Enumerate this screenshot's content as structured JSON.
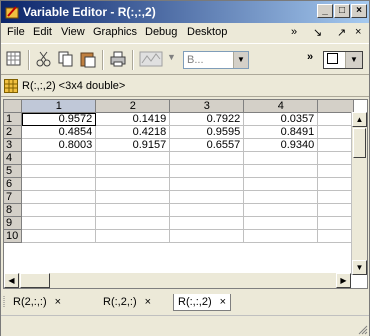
{
  "window": {
    "title": "Variable Editor - R(:,:,2)"
  },
  "title_buttons": {
    "minimize": "_",
    "maximize": "□",
    "close": "×"
  },
  "menu": {
    "items": [
      "File",
      "Edit",
      "View",
      "Graphics",
      "Debug",
      "Desktop"
    ],
    "more": "»",
    "dock": "↘",
    "undock": "↗",
    "close": "×"
  },
  "toolbar": {
    "plot_combo_text": "B...",
    "more": "»",
    "icons": [
      "new-variable-icon",
      "cut-icon",
      "copy-icon",
      "paste-icon",
      "print-icon",
      "plot-icon"
    ]
  },
  "variable": {
    "label": "R(:,:,2) <3x4 double>"
  },
  "table": {
    "columns": [
      "1",
      "2",
      "3",
      "4"
    ],
    "rows": [
      {
        "label": "1",
        "cells": [
          "0.9572",
          "0.1419",
          "0.7922",
          "0.0357"
        ]
      },
      {
        "label": "2",
        "cells": [
          "0.4854",
          "0.4218",
          "0.9595",
          "0.8491"
        ]
      },
      {
        "label": "3",
        "cells": [
          "0.8003",
          "0.9157",
          "0.6557",
          "0.9340"
        ]
      },
      {
        "label": "4",
        "cells": [
          "",
          "",
          "",
          ""
        ]
      },
      {
        "label": "5",
        "cells": [
          "",
          "",
          "",
          ""
        ]
      },
      {
        "label": "6",
        "cells": [
          "",
          "",
          "",
          ""
        ]
      },
      {
        "label": "7",
        "cells": [
          "",
          "",
          "",
          ""
        ]
      },
      {
        "label": "8",
        "cells": [
          "",
          "",
          "",
          ""
        ]
      },
      {
        "label": "9",
        "cells": [
          "",
          "",
          "",
          ""
        ]
      },
      {
        "label": "10",
        "cells": [
          "",
          "",
          "",
          ""
        ]
      }
    ]
  },
  "tabs": [
    {
      "label": "R(2,:,:)",
      "close": "×",
      "active": false
    },
    {
      "label": "R(:,2,:)",
      "close": "×",
      "active": false
    },
    {
      "label": "R(:,:,2)",
      "close": "×",
      "active": true
    }
  ],
  "colors": {
    "title_start": "#0a246a",
    "title_end": "#a6caf0",
    "chrome": "#ece9d8"
  }
}
